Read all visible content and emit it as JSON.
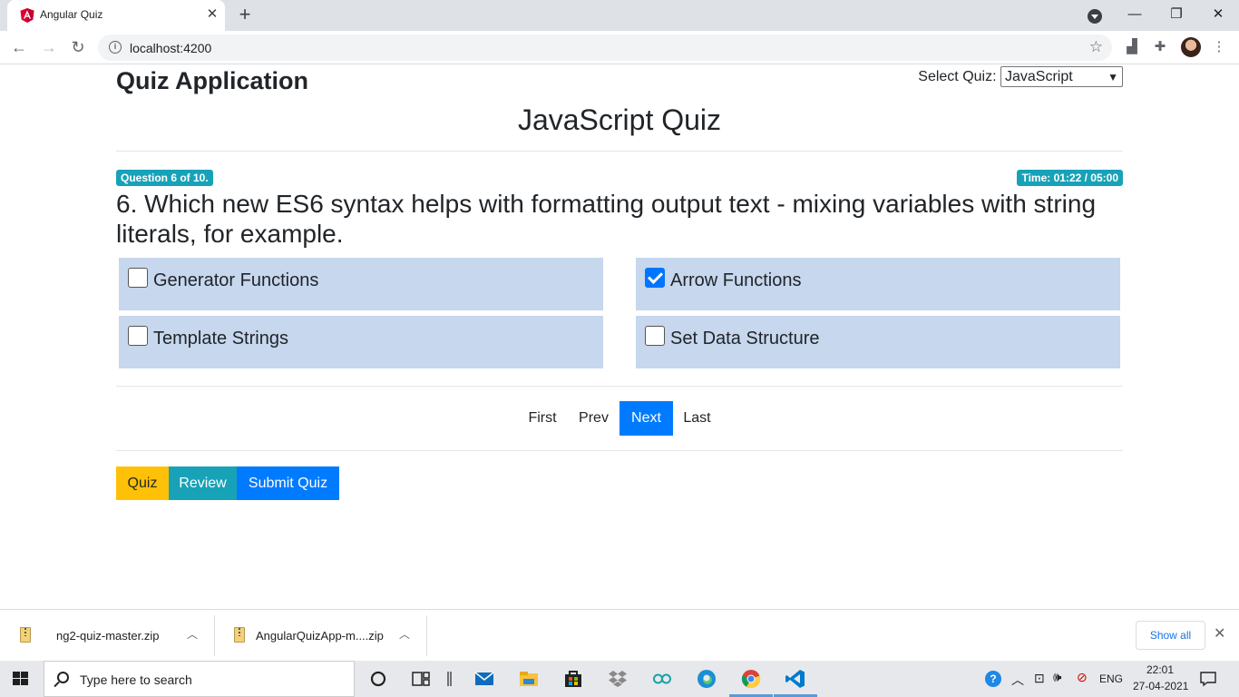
{
  "browser": {
    "tab_title": "Angular Quiz",
    "url": "localhost:4200"
  },
  "page": {
    "app_title": "Quiz Application",
    "select_label": "Select Quiz:",
    "selected_quiz": "JavaScript",
    "quiz_heading": "JavaScript Quiz",
    "question_badge": "Question 6 of 10.",
    "time_badge": "Time: 01:22 / 05:00",
    "question_text": "6. Which new ES6 syntax helps with formatting output text - mixing variables with string literals, for example.",
    "options": [
      {
        "label": "Generator Functions",
        "checked": false
      },
      {
        "label": "Arrow Functions",
        "checked": true
      },
      {
        "label": "Template Strings",
        "checked": false
      },
      {
        "label": "Set Data Structure",
        "checked": false
      }
    ],
    "pager": {
      "first": "First",
      "prev": "Prev",
      "next": "Next",
      "last": "Last"
    },
    "buttons": {
      "quiz": "Quiz",
      "review": "Review",
      "submit": "Submit Quiz"
    }
  },
  "downloads": {
    "items": [
      "ng2-quiz-master.zip",
      "AngularQuizApp-m....zip"
    ],
    "show_all": "Show all"
  },
  "taskbar": {
    "search_placeholder": "Type here to search",
    "language": "ENG",
    "time": "22:01",
    "date": "27-04-2021"
  },
  "colors": {
    "primary": "#007bff",
    "info": "#17a2b8",
    "warning": "#ffc107",
    "option_bg": "#c6d7ee",
    "checkbox_checked": "#0075ff"
  }
}
